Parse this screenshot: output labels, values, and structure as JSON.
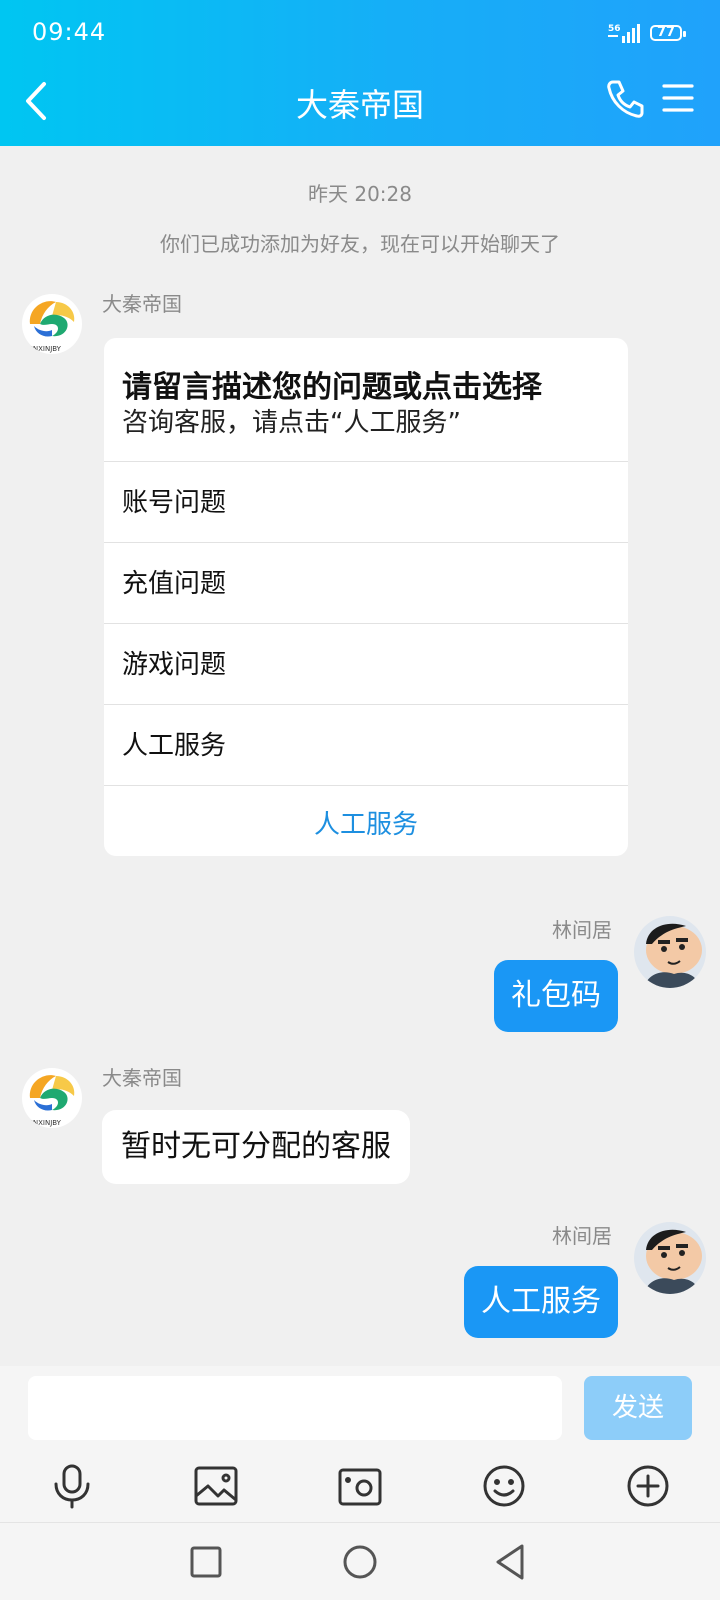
{
  "status_bar": {
    "time": "09:44",
    "network": "56",
    "battery": "77"
  },
  "header": {
    "title": "大秦帝国"
  },
  "chat": {
    "timestamp": "昨天 20:28",
    "system_notice": "你们已成功添加为好友，现在可以开始聊天了",
    "messages": [
      {
        "sender": "大秦帝国",
        "card_title": "请留言描述您的问题或点击选择",
        "card_subtitle": "咨询客服，请点击“人工服务”",
        "options": [
          "账号问题",
          "充值问题",
          "游戏问题",
          "人工服务"
        ],
        "action": "人工服务"
      },
      {
        "sender": "林间居",
        "text": "礼包码"
      },
      {
        "sender": "大秦帝国",
        "text": "暂时无可分配的客服"
      },
      {
        "sender": "林间居",
        "text": "人工服务"
      }
    ]
  },
  "input": {
    "value": "",
    "send_label": "发送"
  },
  "colors": {
    "header_start": "#00c6f2",
    "header_end": "#20a2fb",
    "bubble": "#1a97f5",
    "send_disabled": "#8dcdf9",
    "link": "#1d8fe0"
  }
}
